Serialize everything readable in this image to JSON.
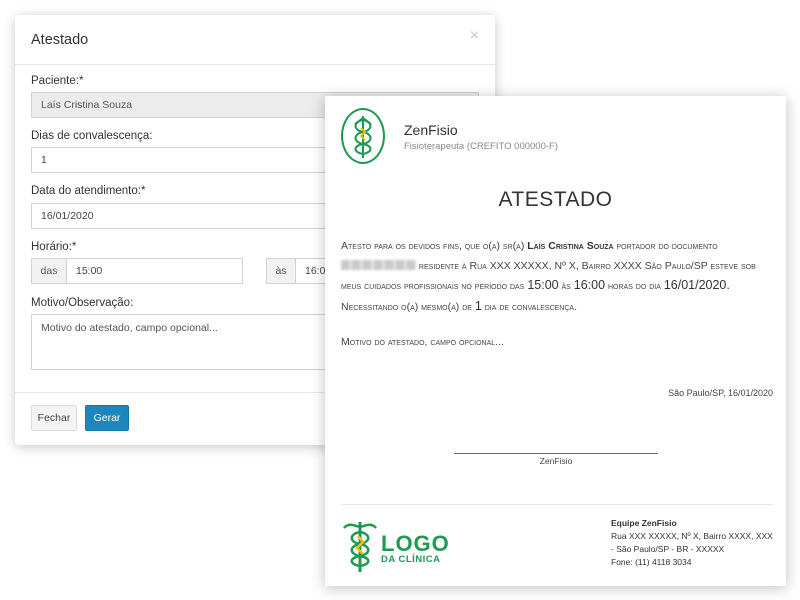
{
  "modal": {
    "title": "Atestado",
    "close_glyph": "×",
    "fields": {
      "paciente_label": "Paciente:*",
      "paciente_value": "Laís Cristina Souza",
      "dias_label": "Dias de convalescença:",
      "dias_value": "1",
      "data_label": "Data do atendimento:*",
      "data_value": "16/01/2020",
      "horario_label": "Horário:*",
      "horario_from_addon": "das",
      "horario_from_value": "15:00",
      "horario_to_addon": "às",
      "horario_to_value": "16:00",
      "motivo_label": "Motivo/Observação:",
      "motivo_value": "Motivo do atestado, campo opcional..."
    },
    "buttons": {
      "close": "Fechar",
      "generate": "Gerar"
    }
  },
  "document": {
    "professional_name": "ZenFisio",
    "professional_sub": "Fisioterapeuta (CREFITO 000000-F)",
    "title": "ATESTADO",
    "body": {
      "p1": "Atesto para os devidos fins, que o(a) sr(a)",
      "patient": "Laís Cristina Souza",
      "p2": "portador do documento",
      "p3": "residente à Rua XXX XXXXX, Nº X, Bairro XXXX São Paulo/SP esteve sob meus cuidados profissionais no período das",
      "time_from": "15:00",
      "p4": "às",
      "time_to": "16:00",
      "p5": "horas do dia",
      "date": "16/01/2020.",
      "p6": "Necessitando o(a) mesmo(a) de",
      "days": "1",
      "p7": "dia de convalescença."
    },
    "motivo": "Motivo do atestado, campo opcional...",
    "place_date": "São Paulo/SP, 16/01/2020",
    "signature_name": "ZenFisio",
    "footer": {
      "logo_big": "LOGO",
      "logo_small": "DA CLÍNICA",
      "contact_title": "Equipe ZenFisio",
      "contact_line1": "Rua XXX XXXXX, Nº X, Bairro XXXX, XXX",
      "contact_line2": "- São Paulo/SP - BR - XXXXX",
      "contact_phone": "Fone: (11) 4118 3034"
    }
  },
  "colors": {
    "brand_green": "#1f9a52",
    "primary_button": "#1b87bd"
  },
  "icons": {
    "header_logo": "caduceus-icon",
    "footer_logo": "caduceus-icon",
    "close": "close-icon"
  }
}
